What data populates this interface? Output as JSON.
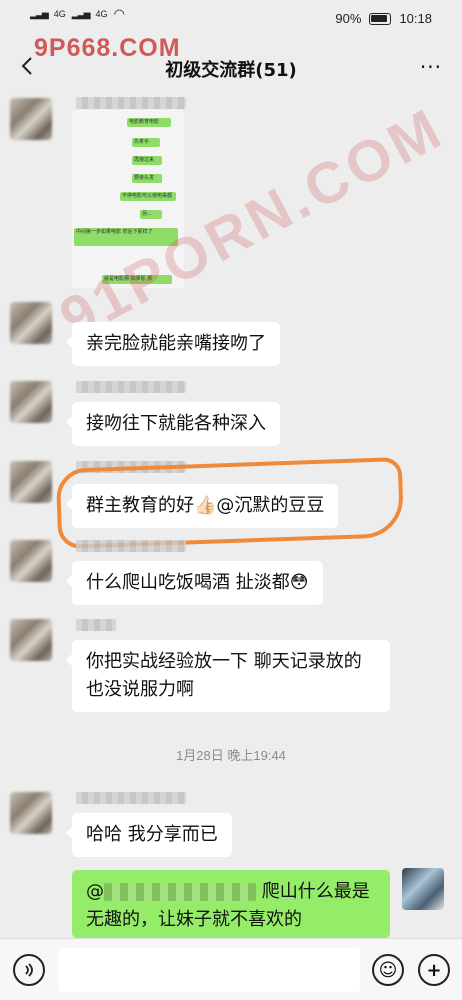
{
  "status_bar": {
    "net1": "4G",
    "net2": "4G",
    "battery": "90%",
    "time": "10:18"
  },
  "watermark": {
    "top": "9P668.COM",
    "diagonal": "91PORN.COM"
  },
  "header": {
    "title": "初级交流群(51)",
    "more": "···"
  },
  "screenshot_texts": [
    "电影教育电影",
    "先拿手",
    "再接过来",
    "要亲头发",
    "不停电影可以使用来都",
    "另…",
    "中间第一步如果电影 然后下那样了",
    "就是电影那 如果那 那"
  ],
  "messages": [
    {
      "text": "亲完脸就能亲嘴接吻了"
    },
    {
      "text": "接吻往下就能各种深入"
    },
    {
      "text": "群主教育的好👍🏻@沉默的豆豆"
    },
    {
      "text": "什么爬山吃饭喝酒 扯淡都😳"
    },
    {
      "text": "你把实战经验放一下 聊天记录放的也没说服力啊"
    }
  ],
  "timestamp": "1月28日 晚上19:44",
  "messages_after": [
    {
      "text": "哈哈 我分享而已"
    }
  ],
  "self_message": {
    "prefix": "@",
    "text": "爬山什么最是无趣的，让妹子就不喜欢的"
  },
  "input_bar": {
    "placeholder": "",
    "add_label": "+",
    "emoji_label": "☺"
  }
}
